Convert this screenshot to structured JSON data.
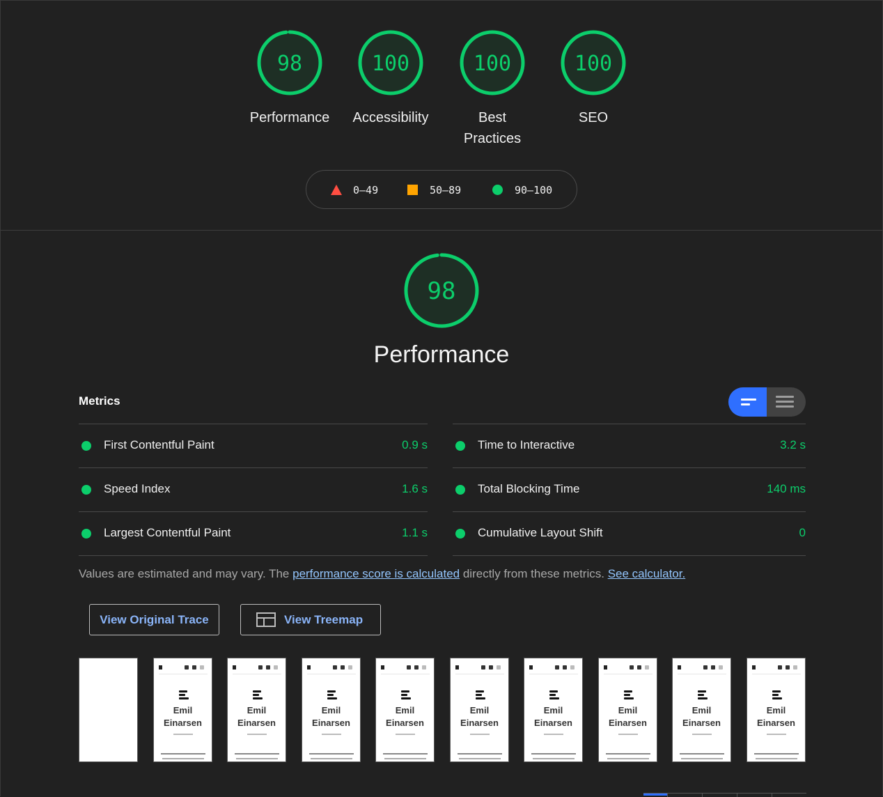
{
  "categories": [
    {
      "score": "98",
      "label": "Performance",
      "fraction": 0.98
    },
    {
      "score": "100",
      "label": "Accessibility",
      "fraction": 1.0
    },
    {
      "score": "100",
      "label": "Best Practices",
      "fraction": 1.0
    },
    {
      "score": "100",
      "label": "SEO",
      "fraction": 1.0
    }
  ],
  "legend": {
    "fail": "0–49",
    "average": "50–89",
    "pass": "90–100"
  },
  "performance": {
    "score": "98",
    "fraction": 0.98,
    "title": "Performance"
  },
  "metrics": {
    "header": "Metrics",
    "left": [
      {
        "name": "First Contentful Paint",
        "value": "0.9 s"
      },
      {
        "name": "Speed Index",
        "value": "1.6 s"
      },
      {
        "name": "Largest Contentful Paint",
        "value": "1.1 s"
      }
    ],
    "right": [
      {
        "name": "Time to Interactive",
        "value": "3.2 s"
      },
      {
        "name": "Total Blocking Time",
        "value": "140 ms"
      },
      {
        "name": "Cumulative Layout Shift",
        "value": "0"
      }
    ]
  },
  "note": {
    "text1": "Values are estimated and may vary. The ",
    "link1": "performance score is calculated",
    "text2": " directly from these metrics. ",
    "link2": "See calculator."
  },
  "buttons": {
    "trace": "View Original Trace",
    "treemap": "View Treemap"
  },
  "filmstrip": {
    "frames": [
      {
        "blank": true,
        "name": ""
      },
      {
        "blank": false,
        "name": "Emil Einarsen"
      },
      {
        "blank": false,
        "name": "Emil Einarsen"
      },
      {
        "blank": false,
        "name": "Emil Einarsen"
      },
      {
        "blank": false,
        "name": "Emil Einarsen"
      },
      {
        "blank": false,
        "name": "Emil Einarsen"
      },
      {
        "blank": false,
        "name": "Emil Einarsen"
      },
      {
        "blank": false,
        "name": "Emil Einarsen"
      },
      {
        "blank": false,
        "name": "Emil Einarsen"
      },
      {
        "blank": false,
        "name": "Emil Einarsen"
      }
    ]
  },
  "colors": {
    "pass": "#0cce6b",
    "average": "#ffa400",
    "fail": "#ff4e42",
    "link": "#93c5fd",
    "toggle_active": "#2f6fff"
  }
}
